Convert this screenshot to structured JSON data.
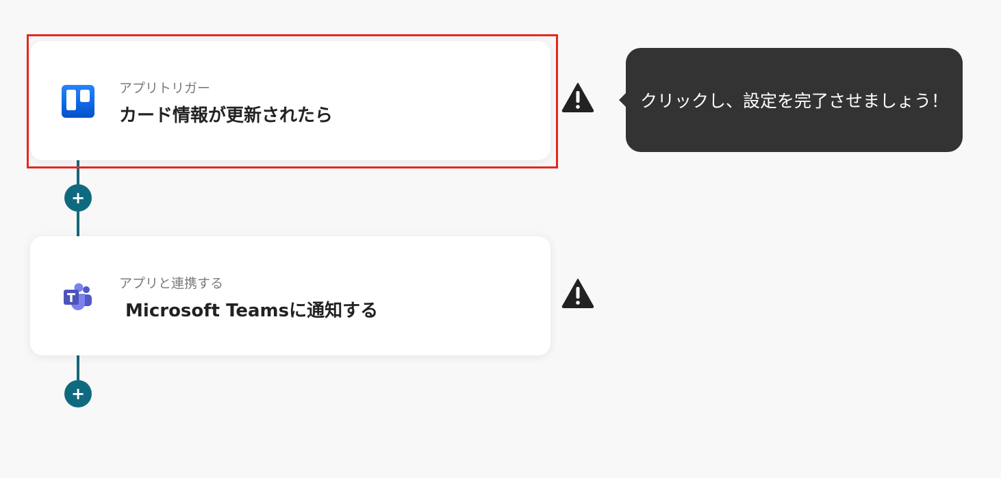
{
  "flow": {
    "steps": [
      {
        "subtitle": "アプリトリガー",
        "title": "カード情報が更新されたら",
        "icon": "trello-icon"
      },
      {
        "subtitle": "アプリと連携する",
        "title": " Microsoft Teamsに通知する",
        "icon": "microsoft-teams-icon"
      }
    ],
    "add_button_label": "+"
  },
  "tooltip": {
    "text": "クリックし、設定を完了させましょう！"
  },
  "colors": {
    "background": "#f8f8f8",
    "connector": "#16697a",
    "add_button": "#0f6a80",
    "highlight": "#e8261c",
    "tooltip_bg": "#333333",
    "warning": "#222222",
    "trello_blue": "#1868db",
    "teams_purple": "#5059c9"
  }
}
